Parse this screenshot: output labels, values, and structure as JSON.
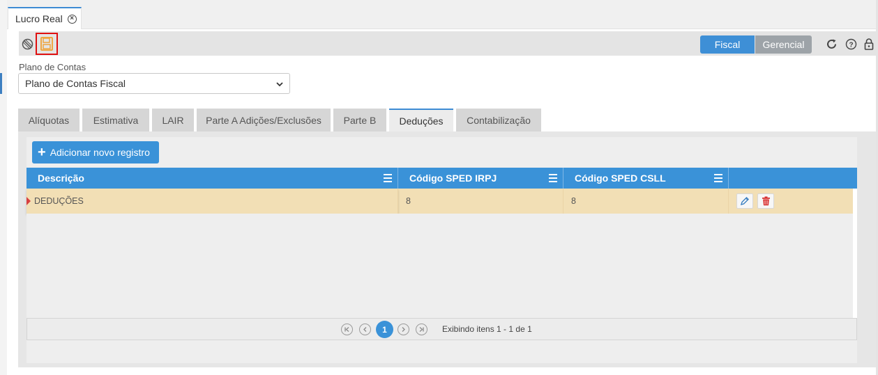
{
  "page_tab": {
    "label": "Lucro Real"
  },
  "toolbar": {
    "mode_buttons": [
      {
        "label": "Fiscal"
      },
      {
        "label": "Gerencial"
      }
    ]
  },
  "plano": {
    "label": "Plano de Contas",
    "selected": "Plano de Contas Fiscal"
  },
  "tabs": [
    {
      "label": "Alíquotas"
    },
    {
      "label": "Estimativa"
    },
    {
      "label": "LAIR"
    },
    {
      "label": "Parte A Adições/Exclusões"
    },
    {
      "label": "Parte B"
    },
    {
      "label": "Deduções"
    },
    {
      "label": "Contabilização"
    }
  ],
  "add_button": {
    "label": "Adicionar novo registro"
  },
  "grid": {
    "columns": [
      "Descrição",
      "Código SPED IRPJ",
      "Código SPED CSLL"
    ],
    "rows": [
      {
        "descricao": "DEDUÇÕES",
        "irpj": "8",
        "csll": "8"
      }
    ]
  },
  "pager": {
    "current": "1",
    "info": "Exibindo itens 1 - 1 de 1"
  },
  "colors": {
    "accent": "#3a92d8",
    "selected_row": "#f2dfb5",
    "save_highlight": "#e01010"
  }
}
